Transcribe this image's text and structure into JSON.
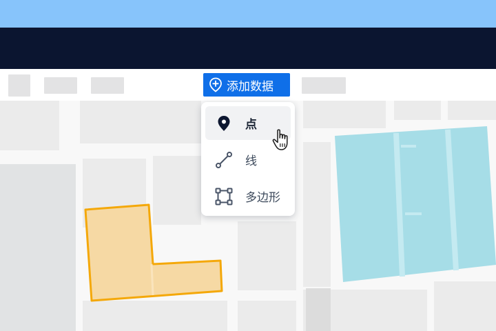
{
  "toolbar": {
    "add_data_label": "添加数据"
  },
  "menu": {
    "items": [
      {
        "label": "点",
        "icon": "map-pin-icon",
        "active": true
      },
      {
        "label": "线",
        "icon": "line-segment-icon",
        "active": false
      },
      {
        "label": "多边形",
        "icon": "polygon-icon",
        "active": false
      }
    ]
  },
  "colors": {
    "accent": "#0f6fe8",
    "navbar": "#0b1530",
    "sky": "#87c4fb",
    "polygon_fill": "#f6d9a4",
    "polygon_stroke": "#f4a80a",
    "water": "#a6dde7"
  }
}
